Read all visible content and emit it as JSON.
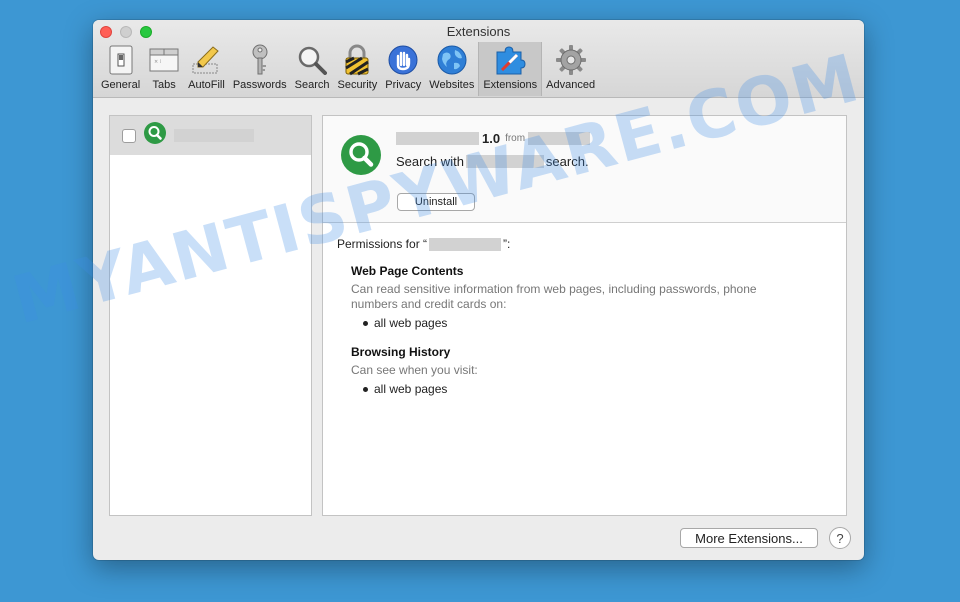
{
  "window": {
    "title": "Extensions"
  },
  "toolbar": {
    "items": [
      {
        "label": "General",
        "icon": "general-switch-icon"
      },
      {
        "label": "Tabs",
        "icon": "tabs-icon"
      },
      {
        "label": "AutoFill",
        "icon": "autofill-pencil-icon"
      },
      {
        "label": "Passwords",
        "icon": "key-icon"
      },
      {
        "label": "Search",
        "icon": "magnifier-icon"
      },
      {
        "label": "Security",
        "icon": "lock-icon"
      },
      {
        "label": "Privacy",
        "icon": "hand-icon"
      },
      {
        "label": "Websites",
        "icon": "globe-icon"
      },
      {
        "label": "Extensions",
        "icon": "puzzle-compass-icon",
        "active": true
      },
      {
        "label": "Advanced",
        "icon": "gear-icon"
      }
    ]
  },
  "extension": {
    "version": "1.0",
    "from_label": "from",
    "desc_prefix": "Search with",
    "desc_suffix": "search.",
    "uninstall_label": "Uninstall"
  },
  "permissions": {
    "title_prefix": "Permissions for “",
    "title_suffix": "”:",
    "groups": [
      {
        "heading": "Web Page Contents",
        "desc": "Can read sensitive information from web pages, including passwords, phone numbers and credit cards on:",
        "bullet": "all web pages"
      },
      {
        "heading": "Browsing History",
        "desc": "Can see when you visit:",
        "bullet": "all web pages"
      }
    ]
  },
  "footer": {
    "more_label": "More Extensions...",
    "help_label": "?"
  },
  "watermark": "MYANTISPYWARE.COM",
  "colors": {
    "desktop": "#3d97d3",
    "extension_green": "#2e9a45"
  }
}
